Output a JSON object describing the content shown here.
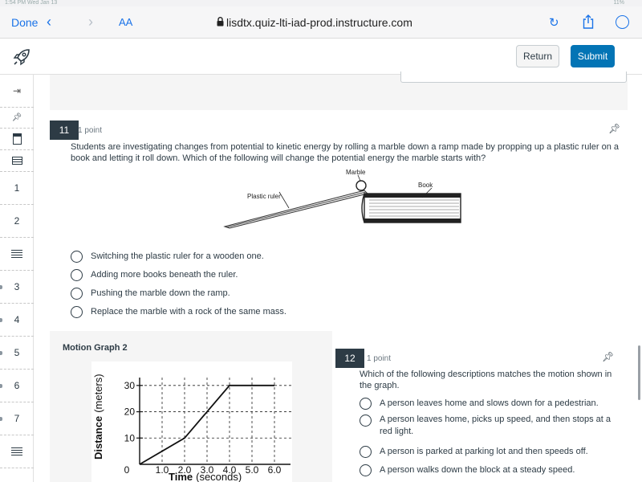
{
  "status_bar": {
    "left": "1:54 PM  Wed Jan 13",
    "right": "11%"
  },
  "browser": {
    "done_label": "Done",
    "text_size_label": "AA",
    "url": "lisdtx.quiz-lti-iad-prod.instructure.com",
    "icons": [
      "back-icon",
      "forward-icon",
      "lock-icon",
      "reload-icon",
      "share-icon",
      "compass-icon"
    ]
  },
  "quiz_header": {
    "logo_icon": "rocket-icon",
    "return_label": "Return",
    "submit_label": "Submit",
    "accent": "#0374b5"
  },
  "nav": {
    "icons": [
      "collapse-arrow-icon",
      "pin-icon",
      "page-icon",
      "list-icon"
    ],
    "items": [
      {
        "label": "1",
        "flagged": false
      },
      {
        "label": "2",
        "flagged": false
      },
      {
        "label": "",
        "type": "lines-icon"
      },
      {
        "label": "3",
        "flagged": true
      },
      {
        "label": "4",
        "flagged": true
      },
      {
        "label": "5",
        "flagged": true
      },
      {
        "label": "6",
        "flagged": true
      },
      {
        "label": "7",
        "flagged": true
      },
      {
        "label": "",
        "type": "lines-icon"
      }
    ]
  },
  "q11": {
    "number": "11",
    "points": "1 point",
    "text": "Students are investigating changes from potential to kinetic energy by rolling a marble down a ramp made by propping up a plastic ruler on a book and letting it roll down. Which of the following will change the potential energy the marble starts with?",
    "diagram": {
      "label_marble": "Marble",
      "label_book": "Book",
      "label_ruler": "Plastic ruler"
    },
    "options": [
      "Switching the plastic ruler for a wooden one.",
      "Adding more books beneath the ruler.",
      "Pushing the marble down the ramp.",
      "Replace the marble with a rock of the same mass."
    ]
  },
  "motion_graph": {
    "title": "Motion Graph 2",
    "chart_data": {
      "type": "line",
      "x": [
        0,
        2.0,
        3.0,
        4.0,
        6.0
      ],
      "y": [
        0,
        10,
        20,
        30,
        30
      ],
      "x_ticks": [
        "0",
        "1.0",
        "2.0",
        "3.0",
        "4.0",
        "5.0",
        "6.0"
      ],
      "y_ticks": [
        "10",
        "20",
        "30"
      ],
      "xlabel_bold": "Time",
      "xlabel_rest": "(seconds)",
      "ylabel_bold": "Distance",
      "ylabel_rest": "(meters)",
      "xlim": [
        0,
        6
      ],
      "ylim": [
        0,
        33
      ],
      "grid": true
    }
  },
  "q12": {
    "number": "12",
    "points": "1 point",
    "text": "Which of the following descriptions matches the motion shown in the graph.",
    "options": [
      "A person leaves home and slows down for a pedestrian.",
      "A person leaves home, picks up speed, and then stops at a red light.",
      "A person is parked at parking lot and then speeds off.",
      "A person walks down the block at a steady speed."
    ]
  }
}
